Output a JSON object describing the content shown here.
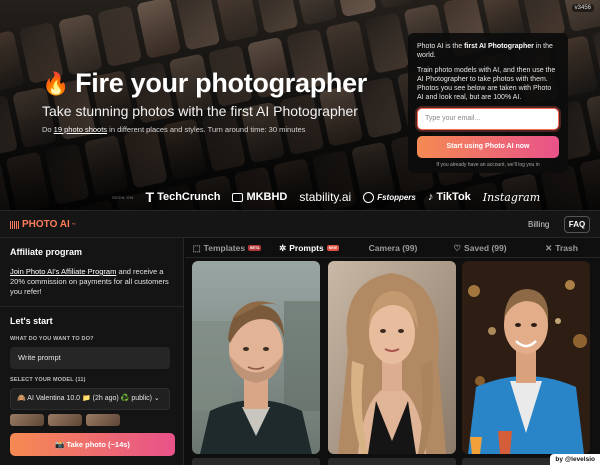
{
  "hero": {
    "version": "v3456",
    "title": "Fire your photographer",
    "subtitle": "Take stunning photos with the first AI Photographer",
    "meta_pre": "Do ",
    "meta_link": "19 photo shoots",
    "meta_post": " in different places and styles. Turn around time: 30 minutes"
  },
  "signup": {
    "p1_pre": "Photo AI is the ",
    "p1_bold": "first AI Photographer",
    "p1_post": " in the world.",
    "p2": "Train photo models with AI, and then use the AI Photographer to take photos with them. Photos you see below are taken with Photo AI and look real, but are 100% AI.",
    "email_placeholder": "Type your email...",
    "cta": "Start using Photo AI now",
    "login_note": "If you already have an account, we'll log you in"
  },
  "press": {
    "label": "SEEN ON",
    "logos": [
      "TechCrunch",
      "MKBHD",
      "stability.ai",
      "Fstoppers",
      "TikTok",
      "Instagram"
    ]
  },
  "appbar": {
    "brand": "PHOTO AI",
    "brand_mark": "™",
    "billing": "Billing",
    "faq": "FAQ"
  },
  "sidebar": {
    "affiliate_title": "Affiliate program",
    "affiliate_link": "Join Photo AI's Affiliate Program",
    "affiliate_text": " and receive a 20% commission on payments for all customers you refer!",
    "start_title": "Let's start",
    "want_label": "WHAT DO YOU WANT TO DO?",
    "prompt_value": "Write prompt",
    "model_label": "SELECT YOUR MODEL (11)",
    "model_value": "🙈 AI Valentina 10.0 📁 (2h ago) ♻️ public) ⌄",
    "take_photo": "📸 Take photo (~14s)"
  },
  "tabs": [
    {
      "icon": "⬚",
      "label": "Templates",
      "badge": "BETA"
    },
    {
      "icon": "✲",
      "label": "Prompts",
      "badge": "NEW"
    },
    {
      "icon": "",
      "label": "Camera (99)",
      "badge": ""
    },
    {
      "icon": "♡",
      "label": "Saved (99)",
      "badge": ""
    },
    {
      "icon": "✕",
      "label": "Trash",
      "badge": ""
    }
  ],
  "credit": "by @levelsio",
  "colors": {
    "accent_start": "#f58a52",
    "accent_end": "#e8528a",
    "brand": "#ff7b5a"
  }
}
